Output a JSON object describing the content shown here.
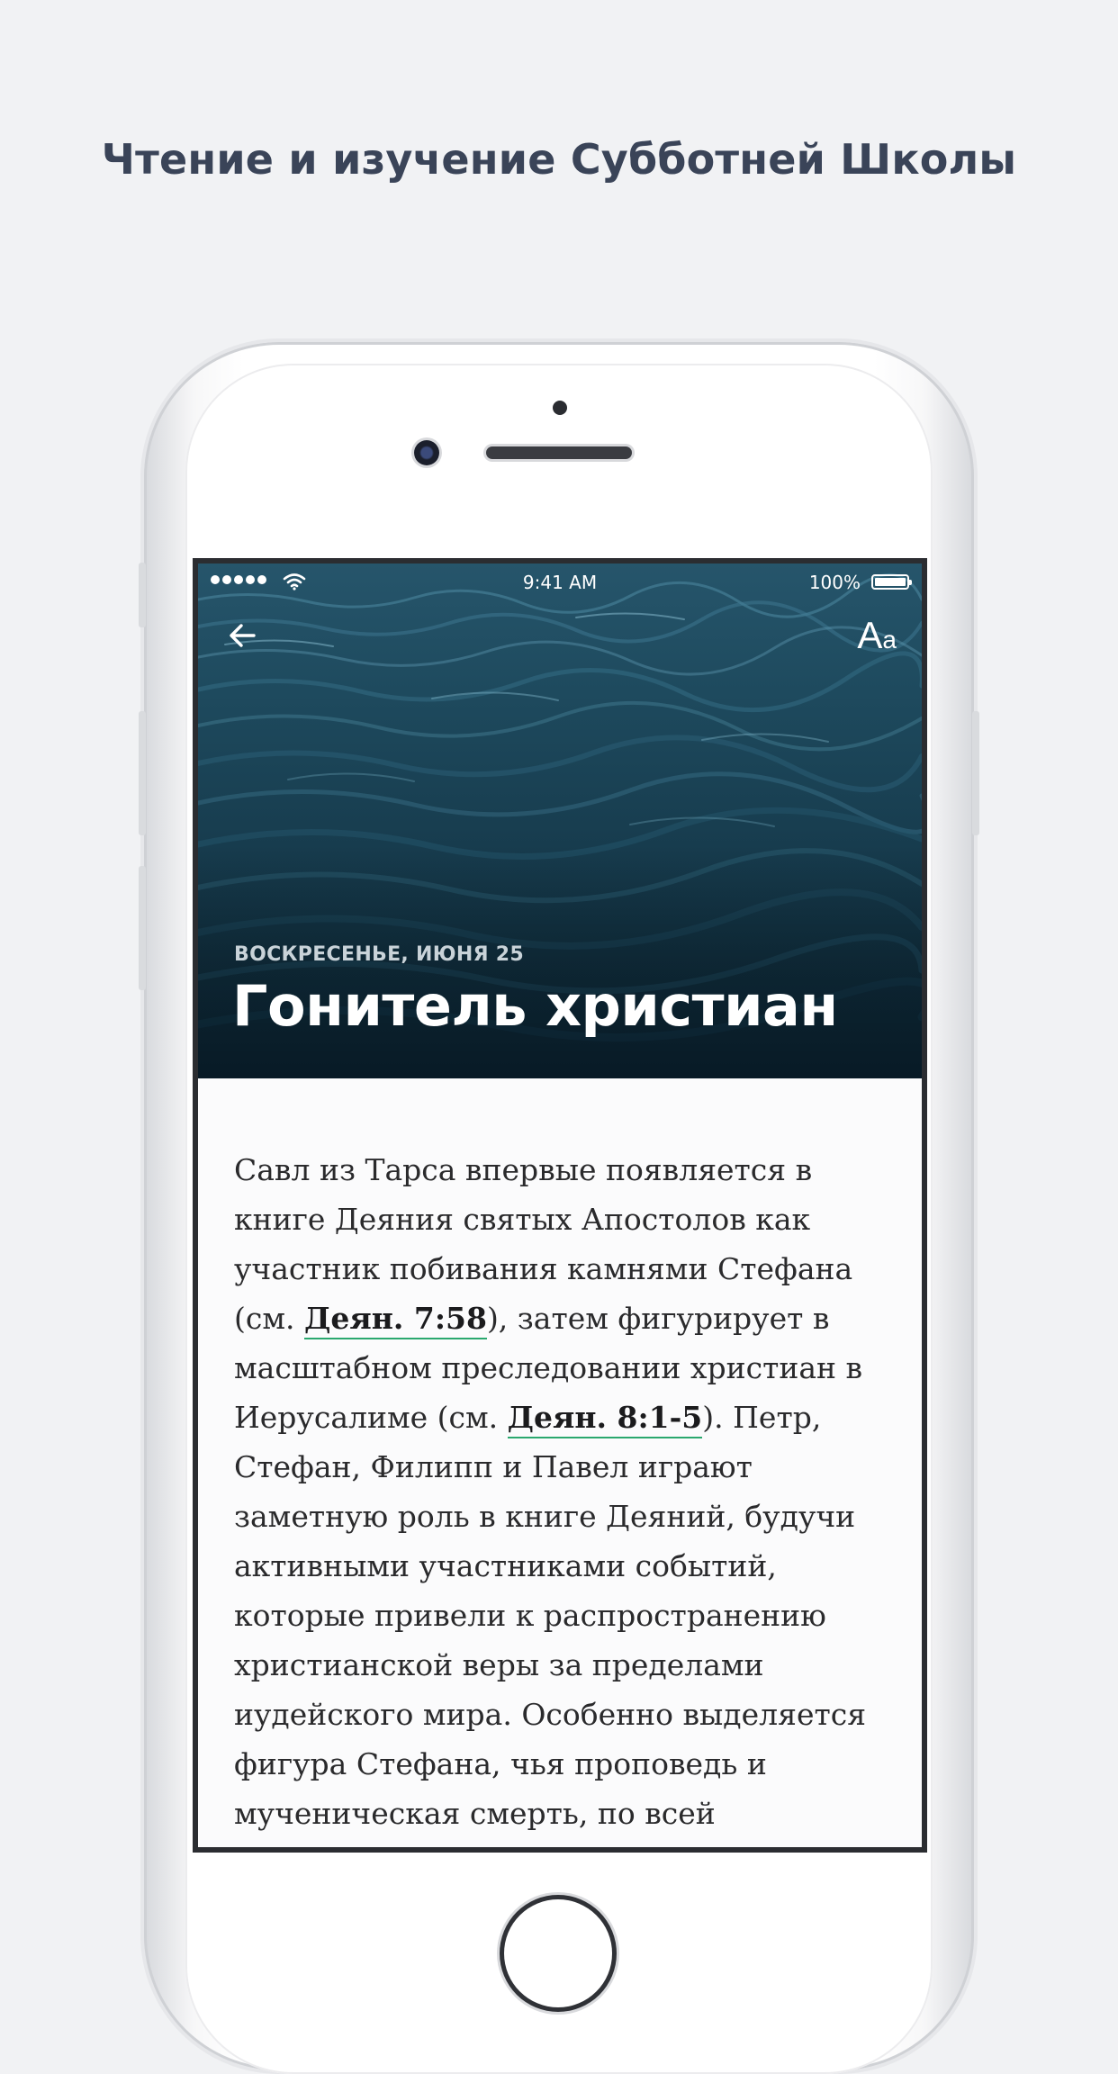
{
  "headline": "Чтение и изучение Субботней Школы",
  "status_bar": {
    "time": "9:41 AM",
    "battery": "100%"
  },
  "nav": {
    "back_icon": "arrow-left-icon",
    "font_button_big": "A",
    "font_button_small": "a"
  },
  "hero": {
    "date": "ВОСКРЕСЕНЬЕ, ИЮНЯ 25",
    "title": "Гонитель христиан"
  },
  "article": {
    "l1": "Савл из Тарса впервые появляется в",
    "l2": "книге Деяния святых Апостолов как",
    "l3": "участник побивания камнями Стефана",
    "l4_a": "(см. ",
    "l4_ref": "Деян. 7:58",
    "l4_b": "), затем фигурирует в",
    "l5": "масштабном преследовании христиан в",
    "l6_a": "Иерусалиме (см. ",
    "l6_ref": "Деян. 8:1-5",
    "l6_b": "). Петр,",
    "l7": "Стефан, Филипп и Павел играют",
    "l8": "заметную роль в книге Деяний, будучи",
    "l9": "активными участниками событий,",
    "l10": "которые привели к распространению",
    "l11": "христианской веры за пределами",
    "l12": "иудейского мира. Особенно выделяется",
    "l13": "фигура Стефана, чья проповедь и",
    "l14": "мученическая смерть, по всей"
  },
  "colors": {
    "background": "#f1f2f4",
    "headline": "#3a4458",
    "link_underline": "#2aa86e",
    "hero_water": "#173c4e"
  }
}
